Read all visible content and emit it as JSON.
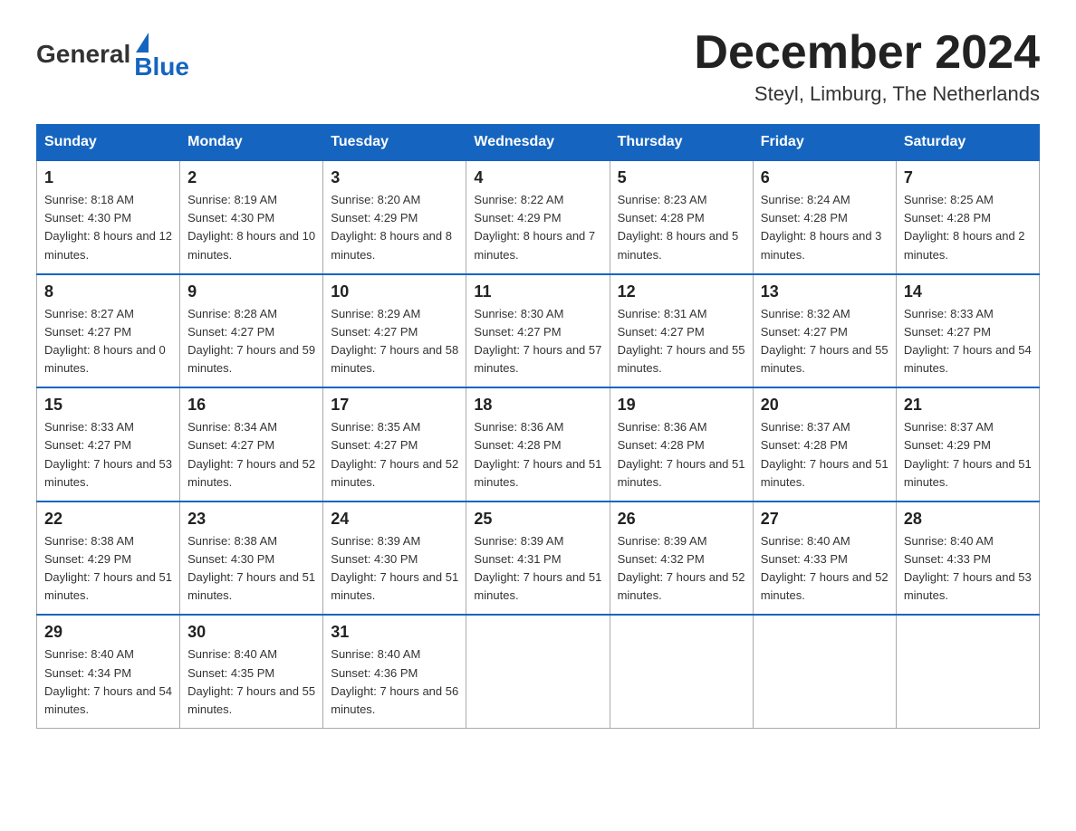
{
  "logo": {
    "text_general": "General",
    "text_blue": "Blue"
  },
  "title": "December 2024",
  "location": "Steyl, Limburg, The Netherlands",
  "days_of_week": [
    "Sunday",
    "Monday",
    "Tuesday",
    "Wednesday",
    "Thursday",
    "Friday",
    "Saturday"
  ],
  "weeks": [
    [
      {
        "day": "1",
        "sunrise": "8:18 AM",
        "sunset": "4:30 PM",
        "daylight": "8 hours and 12 minutes."
      },
      {
        "day": "2",
        "sunrise": "8:19 AM",
        "sunset": "4:30 PM",
        "daylight": "8 hours and 10 minutes."
      },
      {
        "day": "3",
        "sunrise": "8:20 AM",
        "sunset": "4:29 PM",
        "daylight": "8 hours and 8 minutes."
      },
      {
        "day": "4",
        "sunrise": "8:22 AM",
        "sunset": "4:29 PM",
        "daylight": "8 hours and 7 minutes."
      },
      {
        "day": "5",
        "sunrise": "8:23 AM",
        "sunset": "4:28 PM",
        "daylight": "8 hours and 5 minutes."
      },
      {
        "day": "6",
        "sunrise": "8:24 AM",
        "sunset": "4:28 PM",
        "daylight": "8 hours and 3 minutes."
      },
      {
        "day": "7",
        "sunrise": "8:25 AM",
        "sunset": "4:28 PM",
        "daylight": "8 hours and 2 minutes."
      }
    ],
    [
      {
        "day": "8",
        "sunrise": "8:27 AM",
        "sunset": "4:27 PM",
        "daylight": "8 hours and 0 minutes."
      },
      {
        "day": "9",
        "sunrise": "8:28 AM",
        "sunset": "4:27 PM",
        "daylight": "7 hours and 59 minutes."
      },
      {
        "day": "10",
        "sunrise": "8:29 AM",
        "sunset": "4:27 PM",
        "daylight": "7 hours and 58 minutes."
      },
      {
        "day": "11",
        "sunrise": "8:30 AM",
        "sunset": "4:27 PM",
        "daylight": "7 hours and 57 minutes."
      },
      {
        "day": "12",
        "sunrise": "8:31 AM",
        "sunset": "4:27 PM",
        "daylight": "7 hours and 55 minutes."
      },
      {
        "day": "13",
        "sunrise": "8:32 AM",
        "sunset": "4:27 PM",
        "daylight": "7 hours and 55 minutes."
      },
      {
        "day": "14",
        "sunrise": "8:33 AM",
        "sunset": "4:27 PM",
        "daylight": "7 hours and 54 minutes."
      }
    ],
    [
      {
        "day": "15",
        "sunrise": "8:33 AM",
        "sunset": "4:27 PM",
        "daylight": "7 hours and 53 minutes."
      },
      {
        "day": "16",
        "sunrise": "8:34 AM",
        "sunset": "4:27 PM",
        "daylight": "7 hours and 52 minutes."
      },
      {
        "day": "17",
        "sunrise": "8:35 AM",
        "sunset": "4:27 PM",
        "daylight": "7 hours and 52 minutes."
      },
      {
        "day": "18",
        "sunrise": "8:36 AM",
        "sunset": "4:28 PM",
        "daylight": "7 hours and 51 minutes."
      },
      {
        "day": "19",
        "sunrise": "8:36 AM",
        "sunset": "4:28 PM",
        "daylight": "7 hours and 51 minutes."
      },
      {
        "day": "20",
        "sunrise": "8:37 AM",
        "sunset": "4:28 PM",
        "daylight": "7 hours and 51 minutes."
      },
      {
        "day": "21",
        "sunrise": "8:37 AM",
        "sunset": "4:29 PM",
        "daylight": "7 hours and 51 minutes."
      }
    ],
    [
      {
        "day": "22",
        "sunrise": "8:38 AM",
        "sunset": "4:29 PM",
        "daylight": "7 hours and 51 minutes."
      },
      {
        "day": "23",
        "sunrise": "8:38 AM",
        "sunset": "4:30 PM",
        "daylight": "7 hours and 51 minutes."
      },
      {
        "day": "24",
        "sunrise": "8:39 AM",
        "sunset": "4:30 PM",
        "daylight": "7 hours and 51 minutes."
      },
      {
        "day": "25",
        "sunrise": "8:39 AM",
        "sunset": "4:31 PM",
        "daylight": "7 hours and 51 minutes."
      },
      {
        "day": "26",
        "sunrise": "8:39 AM",
        "sunset": "4:32 PM",
        "daylight": "7 hours and 52 minutes."
      },
      {
        "day": "27",
        "sunrise": "8:40 AM",
        "sunset": "4:33 PM",
        "daylight": "7 hours and 52 minutes."
      },
      {
        "day": "28",
        "sunrise": "8:40 AM",
        "sunset": "4:33 PM",
        "daylight": "7 hours and 53 minutes."
      }
    ],
    [
      {
        "day": "29",
        "sunrise": "8:40 AM",
        "sunset": "4:34 PM",
        "daylight": "7 hours and 54 minutes."
      },
      {
        "day": "30",
        "sunrise": "8:40 AM",
        "sunset": "4:35 PM",
        "daylight": "7 hours and 55 minutes."
      },
      {
        "day": "31",
        "sunrise": "8:40 AM",
        "sunset": "4:36 PM",
        "daylight": "7 hours and 56 minutes."
      },
      null,
      null,
      null,
      null
    ]
  ],
  "labels": {
    "sunrise": "Sunrise:",
    "sunset": "Sunset:",
    "daylight": "Daylight:"
  }
}
